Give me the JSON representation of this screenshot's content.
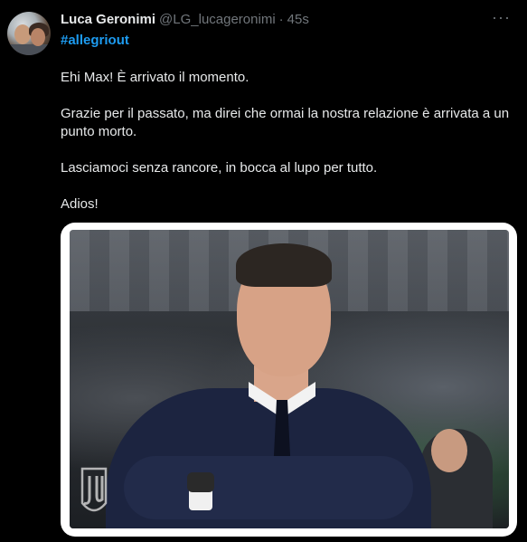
{
  "tweet": {
    "author_name": "Luca Geronimi",
    "author_handle": "@LG_lucageronimi",
    "separator": "·",
    "time": "45s",
    "more_label": "···",
    "hashtag": "#allegriout",
    "paragraphs": [
      "Ehi Max! È arrivato il momento.",
      "Grazie per il passato, ma direi che ormai la nostra relazione è arrivata a un punto morto.",
      "Lasciamoci senza rancore, in bocca al lupo per tutto.",
      "Adios!"
    ]
  },
  "colors": {
    "background": "#000000",
    "text": "#e7e9ea",
    "muted": "#71767b",
    "link": "#1d9bf0"
  },
  "icons": {
    "avatar": "profile-photo",
    "more": "more-horizontal-icon",
    "logo": "juventus-logo"
  }
}
